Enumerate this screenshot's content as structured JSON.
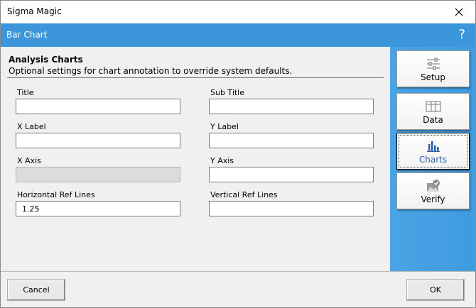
{
  "window": {
    "title": "Sigma Magic"
  },
  "header": {
    "title": "Bar Chart",
    "help": "?"
  },
  "section": {
    "title": "Analysis Charts",
    "subtitle": "Optional settings for chart annotation to override system defaults."
  },
  "form": {
    "title_label": "Title",
    "title_value": "",
    "subtitle_label": "Sub Title",
    "subtitle_value": "",
    "xlabel_label": "X Label",
    "xlabel_value": "",
    "ylabel_label": "Y Label",
    "ylabel_value": "",
    "xaxis_label": "X Axis",
    "xaxis_value": "",
    "yaxis_label": "Y Axis",
    "yaxis_value": "",
    "href_label": "Horizontal Ref Lines",
    "href_value": "1.25",
    "vref_label": "Vertical Ref Lines",
    "vref_value": ""
  },
  "nav": {
    "setup": "Setup",
    "data": "Data",
    "charts": "Charts",
    "verify": "Verify",
    "active": "charts"
  },
  "footer": {
    "cancel": "Cancel",
    "ok": "OK"
  },
  "colors": {
    "header_blue": "#3c96dc",
    "panel_blue": "#4aa3e4",
    "active_label": "#2a5db0"
  }
}
